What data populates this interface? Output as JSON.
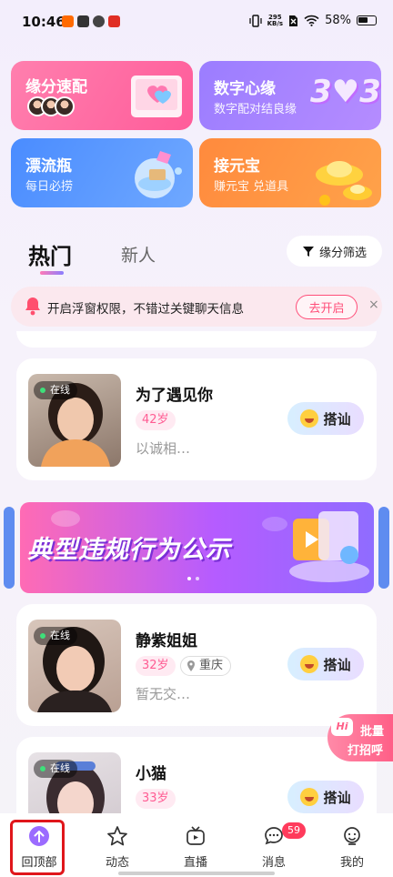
{
  "status_bar": {
    "time": "10:46",
    "net_speed_value": "295",
    "net_speed_unit": "KB/s",
    "battery": "58%"
  },
  "top_cards": [
    {
      "title": "缘分速配",
      "subtitle": ""
    },
    {
      "title": "数字心缘",
      "subtitle": "数字配对结良缘"
    },
    {
      "title": "漂流瓶",
      "subtitle": "每日必捞"
    },
    {
      "title": "接元宝",
      "subtitle": "赚元宝 兑道具"
    }
  ],
  "card_deco": {
    "number": "3♥3"
  },
  "tabs": {
    "hot": "热门",
    "new": "新人"
  },
  "filter_button": "缘分筛选",
  "notify": {
    "text": "开启浮窗权限，不错过关键聊天信息",
    "button": "去开启",
    "close": "×"
  },
  "users": [
    {
      "online": "在线",
      "name": "为了遇见你",
      "age": "42岁",
      "location": "",
      "bio": "以诚相…",
      "action": "搭讪"
    },
    {
      "online": "在线",
      "name": "静紫姐姐",
      "age": "32岁",
      "location": "重庆",
      "bio": "暂无交…",
      "action": "搭讪"
    },
    {
      "online": "在线",
      "name": "小猫",
      "age": "33岁",
      "location": "",
      "bio": "",
      "action": "搭讪"
    }
  ],
  "banner": {
    "text": "典型违规行为公示"
  },
  "bulk_button": {
    "hi": "Hi",
    "line1": "批量",
    "line2": "打招呼"
  },
  "bottom_nav": [
    {
      "label": "回顶部"
    },
    {
      "label": "动态"
    },
    {
      "label": "直播"
    },
    {
      "label": "消息"
    },
    {
      "label": "我的"
    }
  ],
  "message_badge": "59",
  "colors": {
    "accent": "#9b6bff",
    "pink": "#ff5c93",
    "highlight": "#e0161b"
  }
}
